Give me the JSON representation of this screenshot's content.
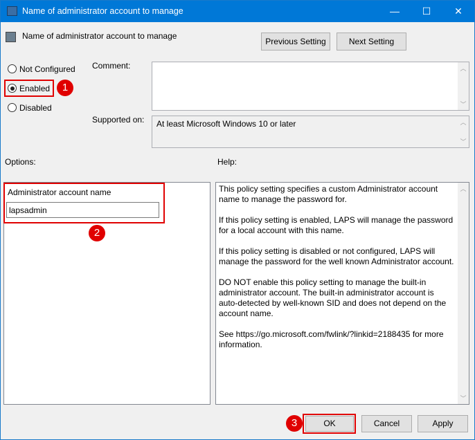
{
  "window": {
    "title": "Name of administrator account to manage",
    "min": "—",
    "max": "☐",
    "close": "✕"
  },
  "header": {
    "title": "Name of administrator account to manage",
    "prev": "Previous Setting",
    "next": "Next Setting"
  },
  "state": {
    "options": [
      "Not Configured",
      "Enabled",
      "Disabled"
    ],
    "selected": "Enabled"
  },
  "comment": {
    "label": "Comment:",
    "value": ""
  },
  "supported": {
    "label": "Supported on:",
    "value": "At least Microsoft Windows 10 or later"
  },
  "options": {
    "label": "Options:",
    "field_label": "Administrator account name",
    "field_value": "lapsadmin"
  },
  "help": {
    "label": "Help:",
    "paragraphs": [
      "This policy setting specifies a custom Administrator account name to manage the password for.",
      "If this policy setting is enabled, LAPS will manage the password for a local account with this name.",
      "If this policy setting is disabled or not configured, LAPS will manage the password for the well known Administrator account.",
      "DO NOT enable this policy setting to manage the built-in administrator account. The built-in administrator account is auto-detected by well-known SID and does not depend on the account name.",
      "See https://go.microsoft.com/fwlink/?linkid=2188435 for more information."
    ]
  },
  "buttons": {
    "ok": "OK",
    "cancel": "Cancel",
    "apply": "Apply"
  },
  "badges": [
    "1",
    "2",
    "3"
  ],
  "colors": {
    "titlebar": "#0078d7",
    "annotation": "#e00000"
  }
}
